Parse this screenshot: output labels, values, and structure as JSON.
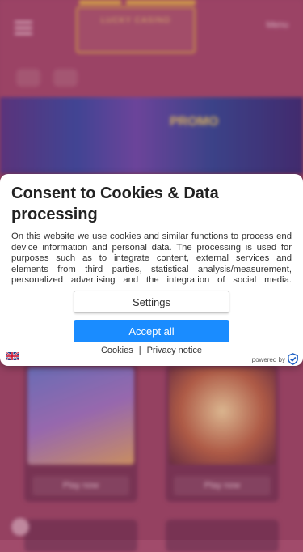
{
  "background": {
    "header": {
      "logo_text": "LUCKY CASINO",
      "menu_text": "Menu"
    },
    "banner": {
      "title": "PROMO",
      "subtitle": ""
    },
    "cards": [
      {
        "button_label": "Play now"
      },
      {
        "button_label": "Play now"
      }
    ]
  },
  "consent": {
    "title": "Consent to Cookies & Data processing",
    "body": "On this website we use cookies and similar functions to process end device information and personal data. The processing is used for purposes such as to integrate content, external services and elements from third parties, statistical analysis/measurement, personalized advertising and the integration of social media. Depending on the function, data may be passed on to third parties and processed by them.",
    "settings_label": "Settings",
    "accept_label": "Accept all",
    "cookies_link": "Cookies",
    "separator": "|",
    "privacy_link": "Privacy notice",
    "powered_by": "powered by",
    "accent_color": "#1a8cff"
  }
}
